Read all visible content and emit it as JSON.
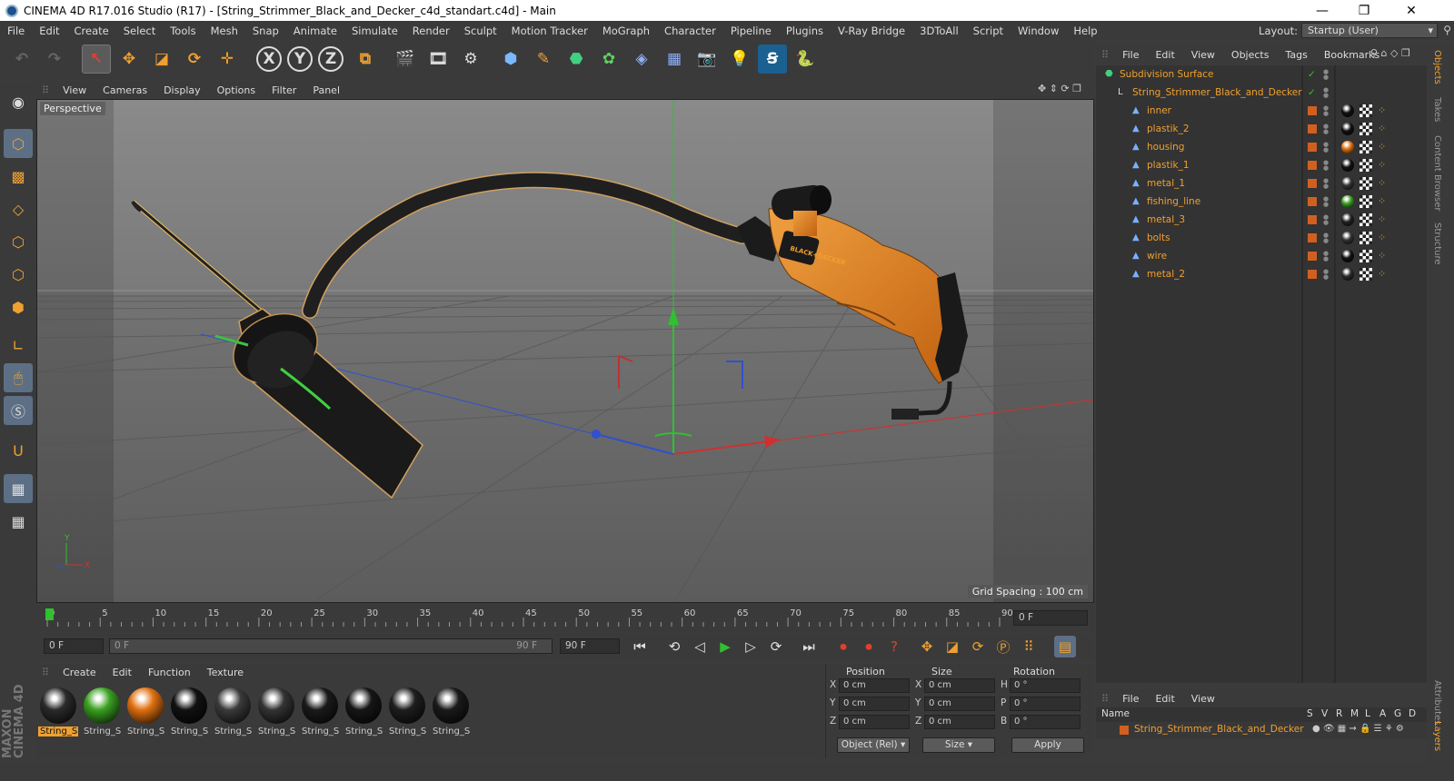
{
  "window": {
    "title": "CINEMA 4D R17.016 Studio (R17) - [String_Strimmer_Black_and_Decker_c4d_standart.c4d] - Main",
    "minimize": "—",
    "maximize": "❐",
    "close": "✕"
  },
  "menubar": {
    "items": [
      "File",
      "Edit",
      "Create",
      "Select",
      "Tools",
      "Mesh",
      "Snap",
      "Animate",
      "Simulate",
      "Render",
      "Sculpt",
      "Motion Tracker",
      "MoGraph",
      "Character",
      "Pipeline",
      "Plugins",
      "V-Ray Bridge",
      "3DToAll",
      "Script",
      "Window",
      "Help"
    ],
    "layout_label": "Layout:",
    "layout_value": "Startup (User)"
  },
  "toolbar": {
    "axis_x": "X",
    "axis_y": "Y",
    "axis_z": "Z"
  },
  "viewport": {
    "menu": [
      "View",
      "Cameras",
      "Display",
      "Options",
      "Filter",
      "Panel"
    ],
    "camera_label": "Perspective",
    "grid_spacing": "Grid Spacing : 100 cm",
    "axis_x": "X",
    "axis_y": "Y",
    "brand_text": "BLACK+DECKER"
  },
  "timeline": {
    "ticks": [
      "0",
      "5",
      "10",
      "15",
      "20",
      "25",
      "30",
      "35",
      "40",
      "45",
      "50",
      "55",
      "60",
      "65",
      "70",
      "75",
      "80",
      "85",
      "90"
    ],
    "current_frame": "0 F",
    "start_frame": "0 F",
    "range_start": "0 F",
    "range_end": "90 F",
    "end_frame": "90 F",
    "preview_end": "90 F"
  },
  "materials": {
    "menu": [
      "Create",
      "Edit",
      "Function",
      "Texture"
    ],
    "items": [
      {
        "label": "String_S",
        "color": "#2a2a2a"
      },
      {
        "label": "String_S",
        "color": "#3aa020"
      },
      {
        "label": "String_S",
        "color": "#e07010"
      },
      {
        "label": "String_S",
        "color": "#111111"
      },
      {
        "label": "String_S",
        "color": "#3a3a3a"
      },
      {
        "label": "String_S",
        "color": "#333333"
      },
      {
        "label": "String_S",
        "color": "#1a1a1a"
      },
      {
        "label": "String_S",
        "color": "#161616"
      },
      {
        "label": "String_S",
        "color": "#1e1e1e"
      },
      {
        "label": "String_S",
        "color": "#1a1a1a"
      }
    ],
    "brand_vertical": "MAXON CINEMA 4D"
  },
  "coordinates": {
    "headers": {
      "position": "Position",
      "size": "Size",
      "rotation": "Rotation"
    },
    "rows": [
      {
        "axis": "X",
        "pos": "0 cm",
        "size_axis": "X",
        "size": "0 cm",
        "rot_axis": "H",
        "rot": "0 °"
      },
      {
        "axis": "Y",
        "pos": "0 cm",
        "size_axis": "Y",
        "size": "0 cm",
        "rot_axis": "P",
        "rot": "0 °"
      },
      {
        "axis": "Z",
        "pos": "0 cm",
        "size_axis": "Z",
        "size": "0 cm",
        "rot_axis": "B",
        "rot": "0 °"
      }
    ],
    "mode": "Object (Rel)",
    "size_mode": "Size",
    "apply": "Apply"
  },
  "objects": {
    "menu": [
      "File",
      "Edit",
      "View",
      "Objects",
      "Tags",
      "Bookmarks"
    ],
    "root": "Subdivision Surface",
    "group": "String_Strimmer_Black_and_Decker",
    "children": [
      {
        "name": "inner",
        "mat": "#111111"
      },
      {
        "name": "plastik_2",
        "mat": "#111111"
      },
      {
        "name": "housing",
        "mat": "#e07010"
      },
      {
        "name": "plastik_1",
        "mat": "#111111"
      },
      {
        "name": "metal_1",
        "mat": "#333333"
      },
      {
        "name": "fishing_line",
        "mat": "#3aa020"
      },
      {
        "name": "metal_3",
        "mat": "#222222"
      },
      {
        "name": "bolts",
        "mat": "#333333"
      },
      {
        "name": "wire",
        "mat": "#111111"
      },
      {
        "name": "metal_2",
        "mat": "#2a2a2a"
      }
    ]
  },
  "side_tabs": [
    "Objects",
    "Takes",
    "Content Browser",
    "Structure",
    "Attributes",
    "Layers"
  ],
  "layers": {
    "menu": [
      "File",
      "Edit",
      "View"
    ],
    "name_header": "Name",
    "cols": [
      "S",
      "V",
      "R",
      "M",
      "L",
      "A",
      "G",
      "D"
    ],
    "row": "String_Strimmer_Black_and_Decker"
  },
  "colors": {
    "accent": "#f0a030",
    "x_axis": "#d03030",
    "y_axis": "#30c030",
    "z_axis": "#3050d0"
  }
}
